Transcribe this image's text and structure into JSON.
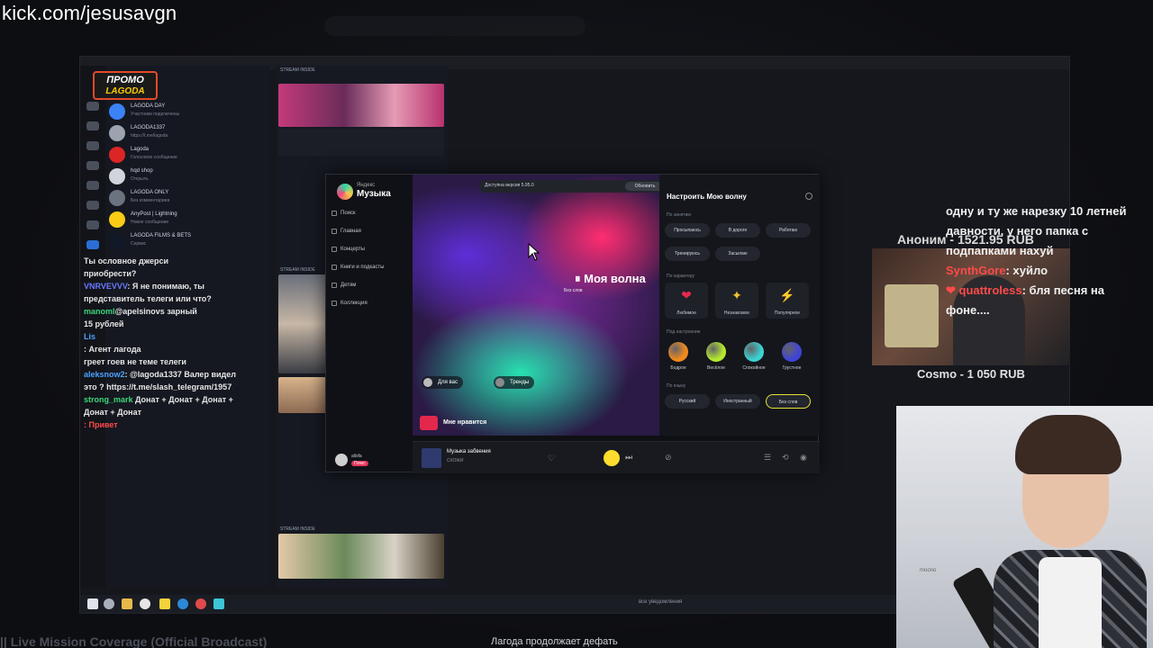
{
  "url": "kick.com/jesusavgn",
  "promo": {
    "line1": "ПРОМО",
    "line2": "LAGODA"
  },
  "telegram": {
    "chats": [
      {
        "name": "LAGODA DAY",
        "sub": "Участники подключены",
        "time": "",
        "color": "#3b82f6"
      },
      {
        "name": "LAGODA1337",
        "sub": "https://t.me/lagoda",
        "time": "",
        "color": "#9ca3af"
      },
      {
        "name": "Lagoda",
        "sub": "Голосовое сообщение",
        "time": "",
        "color": "#dc2626"
      },
      {
        "name": "hqd shop",
        "sub": "Открыть",
        "time": "",
        "color": "#d1d5db"
      },
      {
        "name": "LAGODA ONLY",
        "sub": "Без комментариев",
        "time": "",
        "color": "#6b7280"
      },
      {
        "name": "AnyPost | Lightning",
        "sub": "Новое сообщение",
        "time": "",
        "color": "#facc15"
      },
      {
        "name": "LAGODA FILMS & BETS",
        "sub": "Сервис",
        "time": "",
        "color": "#111827"
      }
    ]
  },
  "chat": [
    {
      "user": "",
      "text": "Ты ословное джерси",
      "cls": "u5"
    },
    {
      "user": "",
      "text": "приобрести?",
      "cls": "u5"
    },
    {
      "user": "VNRVEVVV",
      "text": ": Я не понимаю, ты",
      "cls": "u2"
    },
    {
      "user": "",
      "text": "представитель телеги или что?",
      "cls": "u5"
    },
    {
      "user": "manoml",
      "text": "@apelsinovs зарный",
      "cls": "u3"
    },
    {
      "user": "",
      "text": "15 рублей",
      "cls": "u5"
    },
    {
      "user": "",
      "text": "Lis",
      "cls": "u1"
    },
    {
      "user": "",
      "text": ": Агент лагода",
      "cls": "u5"
    },
    {
      "user": "",
      "text": "греет гоев не теме телеги",
      "cls": "u5"
    },
    {
      "user": "aleksnow2",
      "text": ": @lagoda1337 Валер видел",
      "cls": "u1"
    },
    {
      "user": "",
      "text": "это ? https://t.me/slash_telegram/1957",
      "cls": "u5"
    },
    {
      "user": "strong_mark",
      "text": " Донат + Донат + Донат +",
      "cls": "u3"
    },
    {
      "user": "",
      "text": "Донат + Донат",
      "cls": "u5"
    },
    {
      "user": "",
      "text": ": Привет",
      "cls": "u4"
    }
  ],
  "feed": {
    "label_top": "STREAM INSIDE",
    "label_mid": "STREAM INSIDE",
    "label_bot": "STREAM INSIDE"
  },
  "yandex_music": {
    "logo_small": "Яндекс",
    "logo_big": "Музыка",
    "banner": "Доступна версия 5.95.0",
    "banner_button": "Обновить",
    "nav": [
      "Поиск",
      "Главная",
      "Концерты",
      "Книги и подкасты",
      "Детям",
      "Коллекция"
    ],
    "wave_title": "⏸ Моя волна",
    "wave_chip": "Без слов",
    "chip_left": "Для вас",
    "chip_right": "Тренды",
    "liked": "Мне нравится",
    "user_name": "alisfa",
    "user_badge": "Плюс",
    "settings_title": "Настроить Мою волну",
    "sec_activity": "По занятию",
    "activity": [
      "Просыпаюсь",
      "В дороге",
      "Работаю",
      "Тренируюсь",
      "Засыпаю"
    ],
    "sec_character": "По характеру",
    "character": [
      "Любимое",
      "Незнакомое",
      "Популярное"
    ],
    "sec_mood": "Под настроение",
    "mood": [
      {
        "label": "Бодрое",
        "color": "#f28a1b"
      },
      {
        "label": "Весёлое",
        "color": "#b6ea2e"
      },
      {
        "label": "Спокойное",
        "color": "#3bd2d2"
      },
      {
        "label": "Грустное",
        "color": "#3f44d6"
      }
    ],
    "sec_lang": "По языку",
    "lang": [
      "Русский",
      "Иностранный",
      "Без слов"
    ],
    "track": "Музыка забвения",
    "artist": "СХОЖИ"
  },
  "taskbar_center": "все уведомления",
  "overlay": {
    "anon": "Аноним - 1521.95 RUB",
    "message_head": "одну и ту же нарезку 10 летней давности, у него папка с подпапками нахуй",
    "user1": "SynthGore",
    "text1": ": хуйло",
    "user2": "quattroless",
    "text2": ": бля песня на фоне....",
    "cosmo": "Cosmo - 1 050 RUB"
  },
  "cam_label": "moono",
  "footer_left": "|| Live Mission Coverage (Official Broadcast)",
  "footer_center": "Лагода продолжает дефать"
}
